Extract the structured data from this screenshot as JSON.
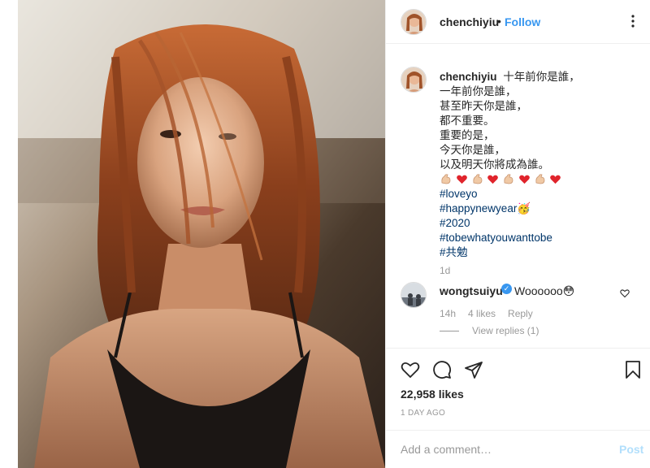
{
  "post": {
    "username": "chenchiyiu",
    "follow_label": "Follow",
    "dot": "•",
    "caption_lines": [
      "十年前你是誰，",
      "一年前你是誰，",
      "甚至昨天你是誰，",
      "都不重要。",
      "重要的是，",
      "今天你是誰，",
      "以及明天你將成為誰。"
    ],
    "hashtags": [
      "#loveyo",
      "#happynewyear🥳",
      "#2020",
      "#tobewhatyouwanttobe",
      "#共勉"
    ],
    "caption_age": "1d",
    "likes": "22,958 likes",
    "posted": "1 DAY AGO"
  },
  "comment": {
    "username": "wongtsuiyu",
    "verified_mark": "✓",
    "text": "Woooooo😳",
    "age": "14h",
    "likes": "4 likes",
    "reply_label": "Reply",
    "view_replies": "View replies (1)"
  },
  "composer": {
    "placeholder": "Add a comment…",
    "post_label": "Post"
  },
  "icons": {
    "more": "more-icon",
    "heart": "heart-icon",
    "comment": "comment-icon",
    "share": "share-icon",
    "save": "bookmark-icon"
  },
  "colors": {
    "follow": "#3897f0",
    "hashtag": "#003569",
    "meta": "#999999",
    "post_button_disabled": "#b2dffc"
  }
}
